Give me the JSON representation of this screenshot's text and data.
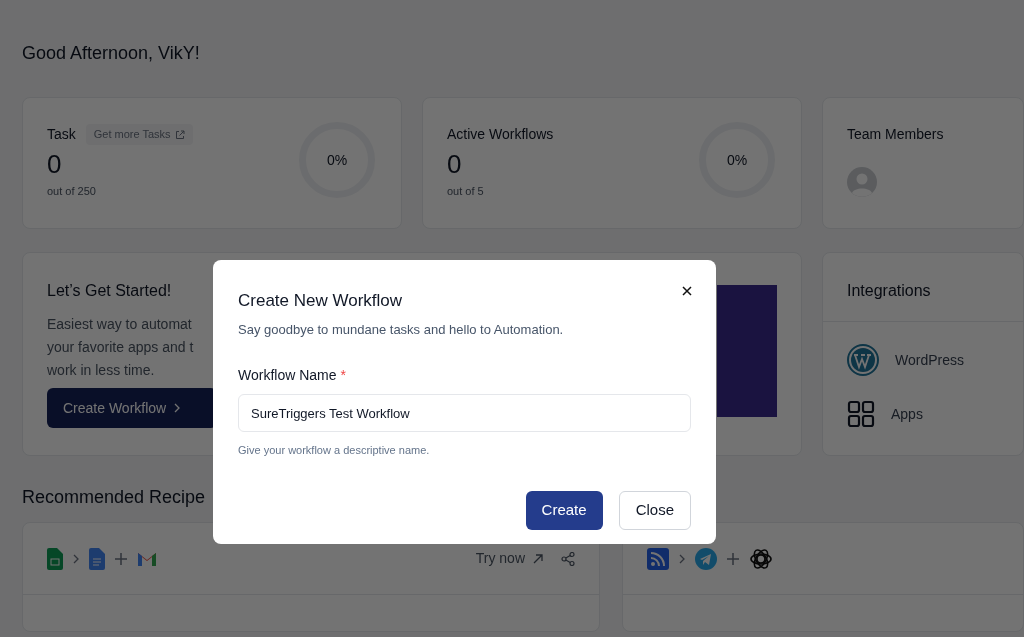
{
  "greeting": "Good Afternoon, VikY!",
  "stats": [
    {
      "title": "Task",
      "link": "Get more Tasks",
      "value": "0",
      "caption": "out of 250",
      "percent": "0%"
    },
    {
      "title": "Active Workflows",
      "value": "0",
      "caption": "out of 5",
      "percent": "0%"
    }
  ],
  "team_members": {
    "title": "Team Members"
  },
  "get_started": {
    "title": "Let’s Get Started!",
    "lines": [
      "Easiest way to automat",
      "your favorite apps and t",
      "work in less time."
    ],
    "button": "Create Workflow"
  },
  "integrations": {
    "title": "Integrations",
    "items": [
      {
        "kind": "wordpress",
        "name": "WordPress"
      },
      {
        "kind": "apps",
        "name": "Apps"
      }
    ]
  },
  "recipes": {
    "title": "Recommended Recipe",
    "cards": [
      {
        "kind": "docs",
        "try_label": "Try now"
      },
      {
        "kind": "feed"
      }
    ]
  },
  "modal": {
    "title": "Create New Workflow",
    "subtitle": "Say goodbye to mundane tasks and hello to Automation.",
    "field_label": "Workflow Name",
    "required_mark": "*",
    "value": "SureTriggers Test Workflow",
    "hint": "Give your workflow a descriptive name.",
    "buttons": [
      {
        "kind": "primary",
        "label": "Create"
      },
      {
        "kind": "secondary",
        "label": "Close"
      }
    ]
  }
}
